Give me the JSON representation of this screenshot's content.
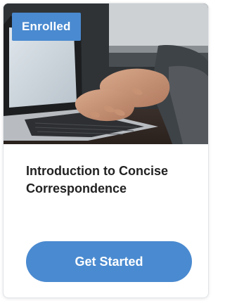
{
  "course_card": {
    "badge_label": "Enrolled",
    "title": "Introduction to Concise Correspondence",
    "cta_label": "Get Started",
    "thumbnail_subject": "hands-typing-on-laptop"
  },
  "colors": {
    "accent": "#4a8ad0",
    "title_text": "#222222",
    "card_border": "#e2e4e7"
  }
}
